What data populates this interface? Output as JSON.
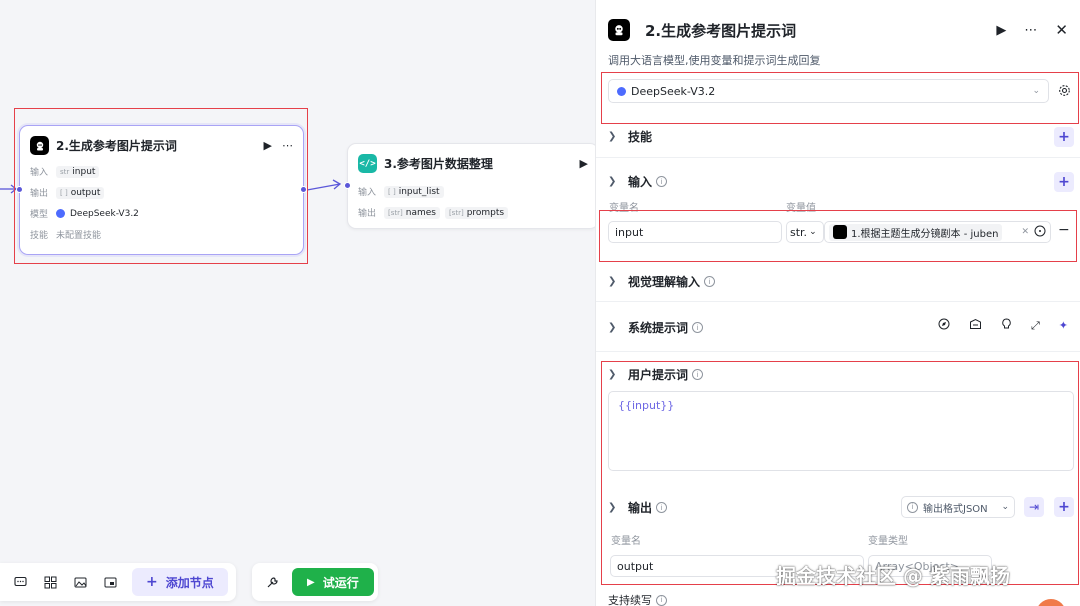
{
  "canvas": {
    "node1": {
      "title": "2.生成参考图片提示词",
      "rows": {
        "input_label": "输入",
        "input_type": "str",
        "input_name": "input",
        "output_label": "输出",
        "output_type": "[ ]",
        "output_name": "output",
        "model_label": "模型",
        "model_name": "DeepSeek-V3.2",
        "skill_label": "技能",
        "skill_value": "未配置技能"
      }
    },
    "node3": {
      "title": "3.参考图片数据整理",
      "rows": {
        "input_label": "输入",
        "input_type": "[ ]",
        "input_name": "input_list",
        "output_label": "输出",
        "output_type1": "[str]",
        "output_name1": "names",
        "output_type2": "[str]",
        "output_name2": "prompts"
      }
    }
  },
  "toolbar": {
    "add_node_label": "添加节点",
    "run_label": "试运行"
  },
  "panel": {
    "title": "2.生成参考图片提示词",
    "description": "调用大语言模型,使用变量和提示词生成回复",
    "model": "DeepSeek-V3.2",
    "sections": {
      "skills": "技能",
      "input": "输入",
      "visual_input": "视觉理解输入",
      "system_prompt": "系统提示词",
      "user_prompt": "用户提示词",
      "output": "输出",
      "continue": "支持续写"
    },
    "input_table": {
      "col_name": "变量名",
      "col_value": "变量值",
      "var_name": "input",
      "var_type": "str.",
      "ref_label": "1.根据主题生成分镜剧本 - juben"
    },
    "user_prompt_text": "{{input}}",
    "output_table": {
      "format_label": "输出格式JSON",
      "col_name": "变量名",
      "col_type": "变量类型",
      "var_name": "output",
      "var_type": "Array<Object>"
    }
  },
  "watermark": "掘金技术社区 @ 紫雨飘扬",
  "colors": {
    "accent": "#4e47d1",
    "run_green": "#1fb14a",
    "highlight_red": "#e5404a",
    "code_teal": "#19b8a6"
  }
}
